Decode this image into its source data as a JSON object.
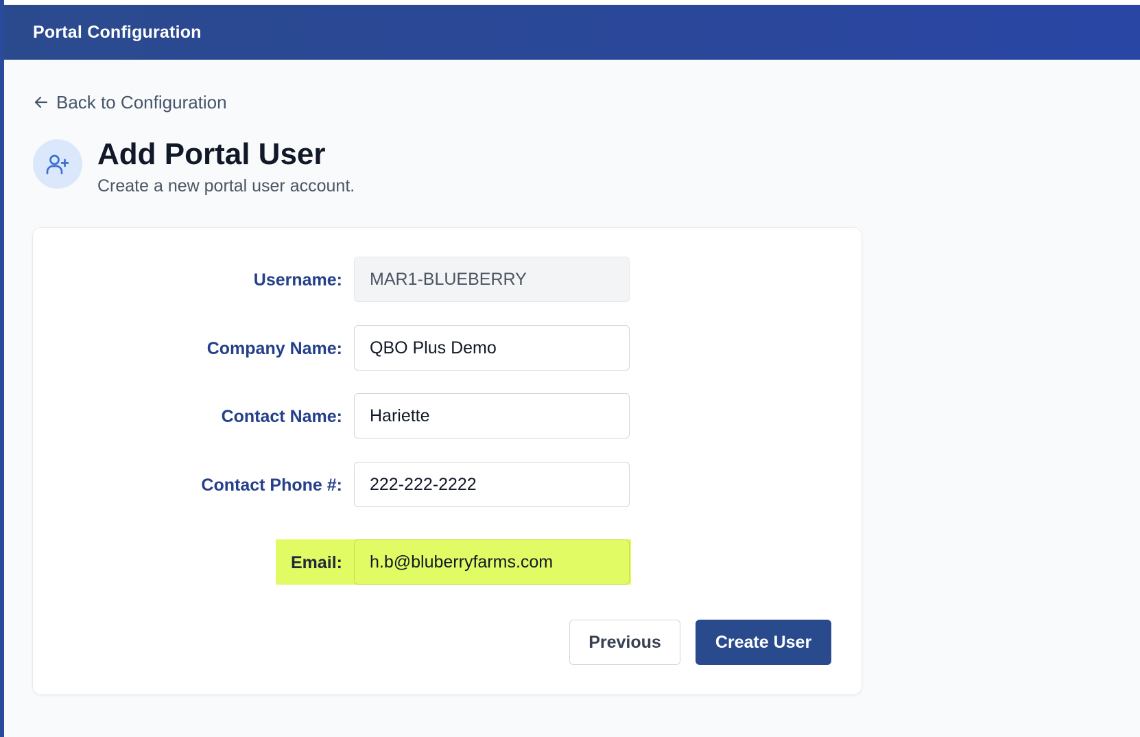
{
  "app": {
    "title": "Portal Configuration"
  },
  "nav": {
    "back_label": "Back to Configuration",
    "back_icon": "arrow-left-icon"
  },
  "page": {
    "icon": "user-plus-icon",
    "title": "Add Portal User",
    "subtitle": "Create a new portal user account."
  },
  "form": {
    "username": {
      "label": "Username:",
      "value": "MAR1-BLUEBERRY",
      "readonly": true
    },
    "company_name": {
      "label": "Company Name:",
      "value": "QBO Plus Demo"
    },
    "contact_name": {
      "label": "Contact Name:",
      "value": "Hariette"
    },
    "contact_phone": {
      "label": "Contact Phone #:",
      "value": "222-222-2222"
    },
    "email": {
      "label": "Email:",
      "value": "h.b@bluberryfarms.com",
      "highlighted": true
    }
  },
  "actions": {
    "previous_label": "Previous",
    "create_label": "Create User"
  },
  "colors": {
    "header": "#2a479a",
    "label": "#24408a",
    "primary_button": "#2a4a8e",
    "highlight": "#e0fb63",
    "icon_circle": "#dbe8fb"
  }
}
